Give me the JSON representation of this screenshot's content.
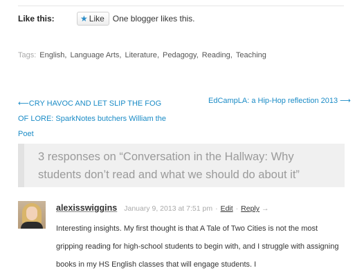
{
  "like_section": {
    "heading": "Like this:",
    "button_label": "Like",
    "count_text": "One blogger likes this."
  },
  "tags": {
    "label": "Tags:",
    "items": [
      "English",
      "Language Arts",
      "Literature",
      "Pedagogy",
      "Reading",
      "Teaching"
    ]
  },
  "post_nav": {
    "prev_arrow": "⟵",
    "prev_title": "CRY HAVOC AND LET SLIP THE FOG OF LORE: SparkNotes butchers William the Poet",
    "next_title": "EdCampLA: a Hip-Hop reflection 2013",
    "next_arrow": "⟶"
  },
  "responses": {
    "title": "3 responses on “Conversation in the Hallway: Why students don’t read and what we should do about it”"
  },
  "comment": {
    "author": "alexisswiggins",
    "date": "January 9, 2013 at 7:51 pm",
    "separator": "·",
    "edit_label": "Edit",
    "reply_label": "Reply",
    "reply_arrow": "→",
    "body": "Interesting insights. My first thought is that A Tale of Two Cities is not the most gripping reading for high-school students to begin with, and I struggle with assigning books in my HS English classes that will engage students. I"
  },
  "colors": {
    "link_blue": "#1a8bc6",
    "like_star": "#2a8cc7",
    "responses_bg": "#f0f0f0",
    "responses_text": "#9a9a9a"
  },
  "icons": {
    "like_star": "star-icon",
    "avatar": "user-avatar-photo"
  }
}
